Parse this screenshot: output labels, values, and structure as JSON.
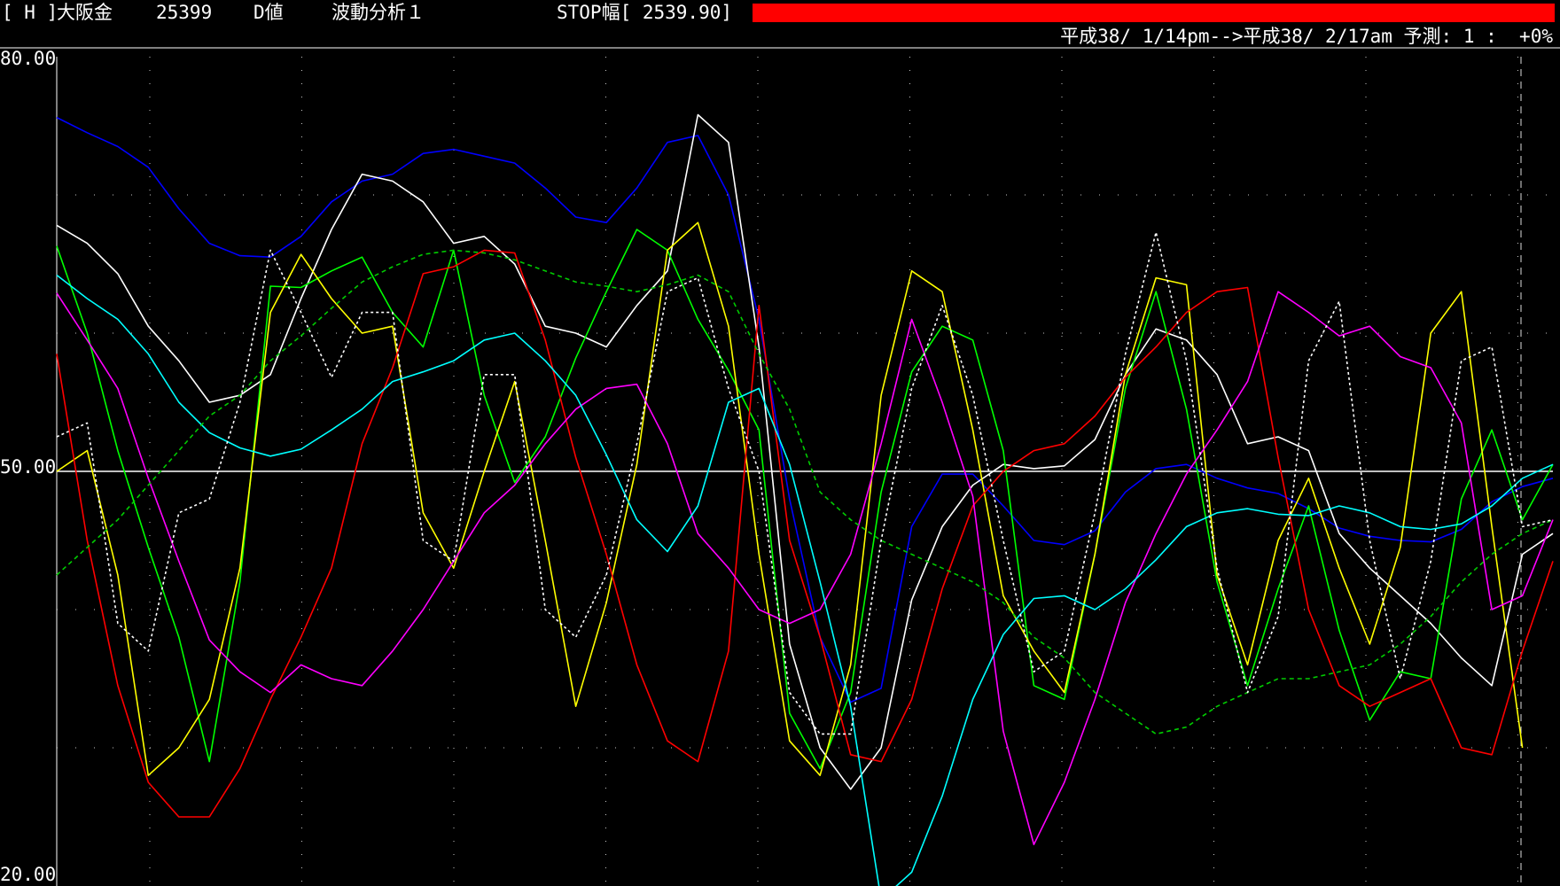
{
  "header": {
    "tag": "[ H ]",
    "symbol": "大阪金",
    "code": "25399",
    "value_type": "D値",
    "analysis": "波動分析１",
    "stop_width": "STOP幅[ 2539.90]",
    "period": "平成38/ 1/14pm-->平成38/ 2/17am 予測: 1 :  +0%"
  },
  "colors": {
    "background": "#000000",
    "stop_bar": "#ff0000",
    "grid": "#c8c8c8",
    "midline": "#ffffff"
  },
  "chart_data": {
    "type": "line",
    "y_tick_labels": [
      "80.00",
      "50.00",
      "20.00"
    ],
    "ylim": [
      20,
      80
    ],
    "midline": 50,
    "x": [
      0,
      1,
      2,
      3,
      4,
      5,
      6,
      7,
      8,
      9,
      10,
      11,
      12,
      13,
      14,
      15,
      16,
      17,
      18,
      19,
      20,
      21,
      22,
      23,
      24,
      25,
      26,
      27,
      28,
      29,
      30,
      31,
      32,
      33,
      34,
      35,
      36,
      37,
      38,
      39,
      40,
      41,
      42,
      43,
      44,
      45,
      46,
      47,
      48,
      49
    ],
    "grid": true,
    "series": [
      {
        "color": "#0000ff",
        "style": "solid",
        "values": [
          75.6,
          74.5,
          73.5,
          72,
          69,
          66.5,
          65.6,
          65.5,
          67,
          69.5,
          71,
          71.5,
          73,
          73.3,
          72.8,
          72.3,
          70.5,
          68.4,
          68,
          70.5,
          73.8,
          74.3,
          70,
          61,
          48,
          38,
          33.3,
          34.3,
          46,
          49.8,
          49.8,
          47.5,
          45,
          44.7,
          45.7,
          48.5,
          50.2,
          50.5,
          49.5,
          48.8,
          48.4,
          47.3,
          45.9,
          45.3,
          45,
          44.9,
          45.8,
          47.8,
          48.9,
          49.5
        ]
      },
      {
        "color": "#ffffff",
        "style": "solid",
        "values": [
          67.8,
          66.5,
          64.3,
          60.5,
          58,
          55,
          55.5,
          57,
          62.5,
          67.5,
          71.5,
          71,
          69.5,
          66.5,
          67,
          65,
          60.5,
          60,
          59,
          62,
          64.5,
          75.8,
          73.8,
          59,
          37.5,
          30,
          27,
          30,
          40.7,
          46,
          49,
          50.5,
          50.2,
          50.4,
          52.3,
          57,
          60.3,
          59.5,
          57,
          52,
          52.5,
          51.5,
          45.5,
          43,
          41,
          39,
          36.5,
          34.5,
          44,
          45.5
        ]
      },
      {
        "color": "#00ff00",
        "style": "solid",
        "values": [
          66.3,
          60,
          51.5,
          44.5,
          38,
          29,
          42,
          63.4,
          63.3,
          64.5,
          65.5,
          61.5,
          59,
          66,
          55.5,
          49.2,
          52.5,
          58.2,
          63,
          67.5,
          66,
          61,
          57.3,
          53,
          32.5,
          28.5,
          34,
          48.5,
          57.2,
          60.5,
          59.5,
          51.5,
          34.5,
          33.5,
          44,
          56,
          63,
          54.5,
          42,
          34.5,
          41.5,
          47.5,
          38.5,
          32,
          35.5,
          35,
          48,
          53,
          46.5,
          50.5
        ]
      },
      {
        "color": "#ffff00",
        "style": "solid",
        "values": [
          50,
          51.5,
          42.5,
          28,
          30,
          33.5,
          43,
          61.5,
          65.7,
          62.5,
          60,
          60.5,
          47,
          43,
          50,
          56.5,
          45,
          33,
          40.5,
          50.5,
          66,
          68,
          60.5,
          44,
          30.5,
          28,
          36,
          55.5,
          64.5,
          63,
          53,
          41,
          37,
          34,
          44,
          57,
          64,
          63.5,
          42.5,
          36,
          45,
          49.5,
          43,
          37.5,
          44.5,
          60,
          63,
          46,
          30
        ]
      },
      {
        "color": "#ff0000",
        "style": "solid",
        "values": [
          58.5,
          45,
          34.5,
          27.5,
          25,
          25,
          28.5,
          33.5,
          38,
          43,
          52,
          57.5,
          64.3,
          64.8,
          66,
          65.8,
          59.5,
          51,
          44,
          36,
          30.5,
          29,
          37,
          62,
          45,
          38,
          29.5,
          29,
          33.5,
          41.5,
          47.5,
          50,
          51.5,
          52,
          54,
          56.8,
          59,
          61.5,
          63,
          63.3,
          51,
          40,
          34.5,
          33,
          34,
          35,
          30,
          29.5,
          37,
          43.5
        ]
      },
      {
        "color": "#ff00ff",
        "style": "solid",
        "values": [
          62.9,
          59.5,
          56,
          49.5,
          43.5,
          37.8,
          35.5,
          34,
          36,
          35,
          34.5,
          37,
          40,
          43.5,
          47,
          49,
          52,
          54.5,
          56,
          56.3,
          52,
          45.5,
          43,
          40,
          39,
          40,
          44,
          52,
          61,
          55,
          48.2,
          31.2,
          23,
          27.5,
          33.5,
          40.5,
          45.5,
          49.8,
          53,
          56.5,
          63,
          61.5,
          59.8,
          60.5,
          58.3,
          57.5,
          53.5,
          40,
          41,
          46.5
        ]
      },
      {
        "color": "#00ffff",
        "style": "solid",
        "values": [
          64.2,
          62.5,
          61,
          58.5,
          55,
          52.8,
          51.7,
          51.1,
          51.6,
          53,
          54.5,
          56.5,
          57.2,
          58,
          59.5,
          60,
          58,
          55.5,
          51.2,
          46.5,
          44.2,
          47.5,
          55,
          56,
          50.5,
          42,
          33,
          19,
          21,
          26.5,
          33.5,
          38.2,
          40.8,
          41,
          40,
          41.5,
          43.6,
          46,
          47,
          47.3,
          46.9,
          46.8,
          47.5,
          47,
          46,
          45.8,
          46.2,
          47.5,
          49.5,
          50.5
        ]
      },
      {
        "color": "#00cc00",
        "style": "dashed",
        "values": [
          42.5,
          44.5,
          46.5,
          49,
          51.5,
          54,
          55.5,
          58,
          59.8,
          61.8,
          63.7,
          64.8,
          65.7,
          66,
          65.8,
          65.3,
          64.5,
          63.7,
          63.4,
          63,
          63.5,
          64.2,
          63,
          58.5,
          54.5,
          48.5,
          46.5,
          45,
          44,
          43,
          42,
          40.5,
          38,
          36.5,
          34,
          32.5,
          31,
          31.5,
          33,
          34,
          35,
          35,
          35.5,
          36,
          37.5,
          39.5,
          42,
          44,
          45.5,
          46.5
        ]
      },
      {
        "color": "#ffffff",
        "style": "dotted",
        "values": [
          52.5,
          53.5,
          39,
          37,
          47,
          48,
          55,
          66,
          61.5,
          56.8,
          61.5,
          61.5,
          45,
          43.5,
          57,
          57,
          40,
          38,
          42.5,
          52,
          63,
          64,
          56,
          50,
          34,
          31,
          31,
          45,
          56,
          62,
          55.5,
          45,
          35.5,
          37,
          47,
          58.5,
          67.3,
          58,
          43,
          34,
          39.5,
          58,
          62.3,
          45,
          35,
          43.5,
          58,
          59,
          46,
          46.5
        ]
      }
    ]
  }
}
